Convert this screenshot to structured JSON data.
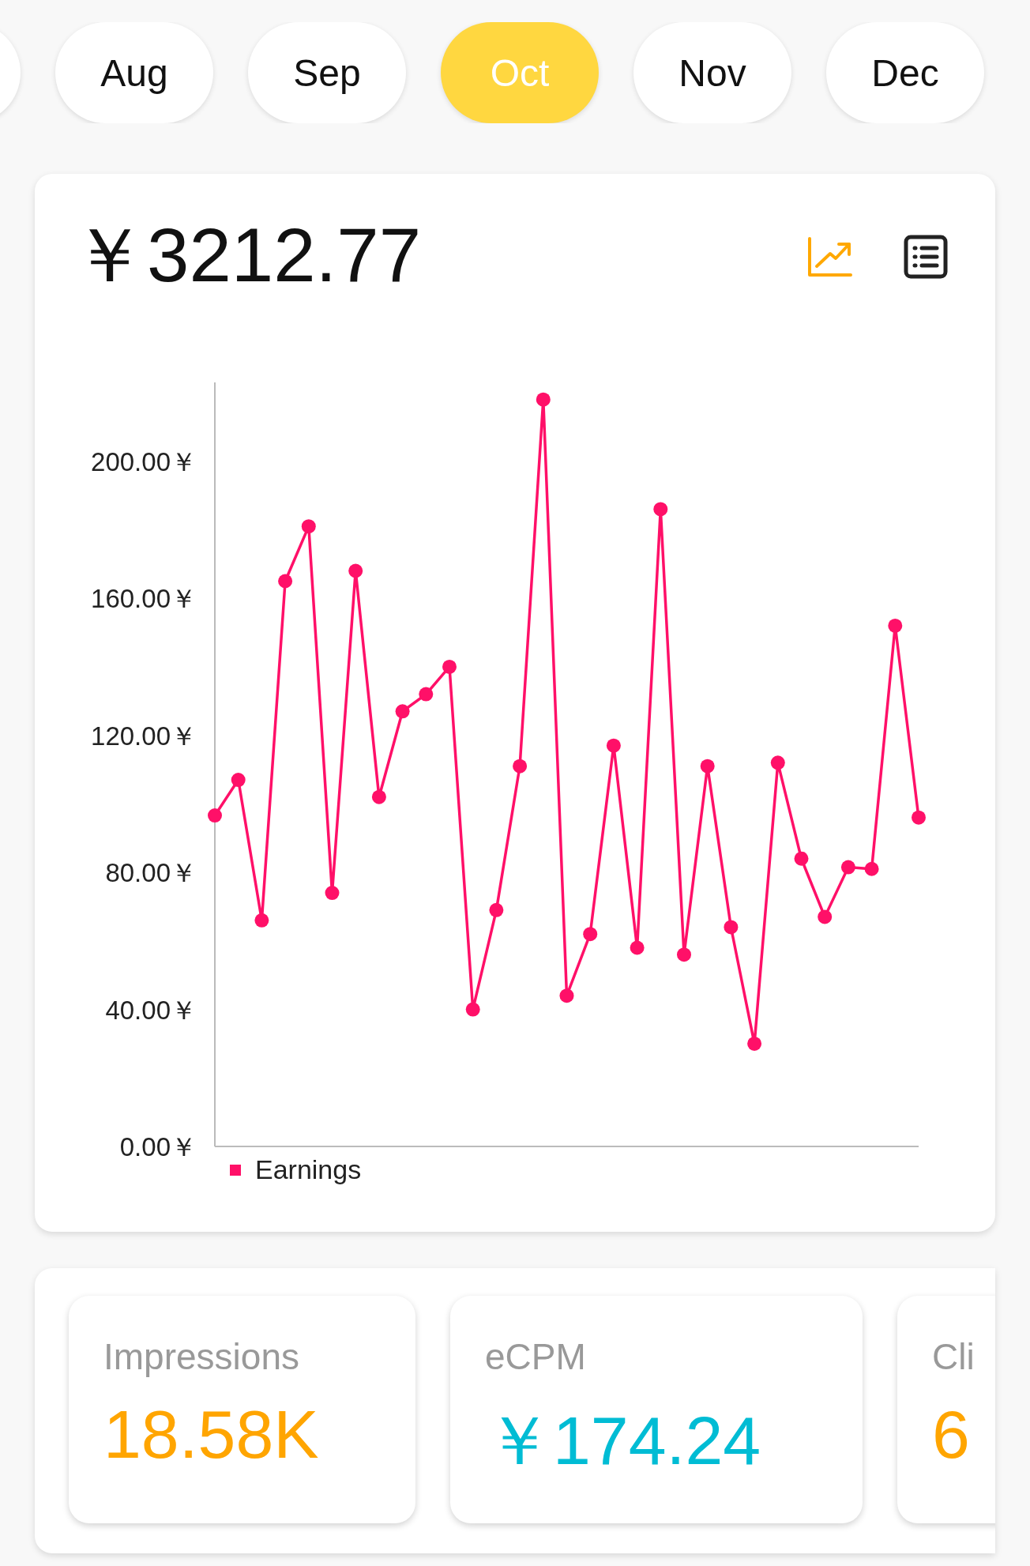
{
  "month_tabs": [
    {
      "kind": "clipped",
      "selected": false
    },
    {
      "kind": "month",
      "label": "Aug",
      "selected": false
    },
    {
      "kind": "month",
      "label": "Sep",
      "selected": false
    },
    {
      "kind": "month",
      "label": "Oct",
      "selected": true
    },
    {
      "kind": "month",
      "label": "Nov",
      "selected": false
    },
    {
      "kind": "month",
      "label": "Dec",
      "selected": false
    }
  ],
  "earnings_card": {
    "total": "￥3212.77",
    "view_toggles": [
      {
        "kind": "chart",
        "selected": true
      },
      {
        "kind": "list",
        "selected": false
      }
    ],
    "chart_data": {
      "type": "line",
      "ylim": [
        0,
        223
      ],
      "yticks": [
        {
          "value": 0,
          "label": "0.00￥"
        },
        {
          "value": 40,
          "label": "40.00￥"
        },
        {
          "value": 80,
          "label": "80.00￥"
        },
        {
          "value": 120,
          "label": "120.00￥"
        },
        {
          "value": 160,
          "label": "160.00￥"
        },
        {
          "value": 200,
          "label": "200.00￥"
        }
      ],
      "series": [
        {
          "name": "Earnings",
          "color": "#ff1068",
          "marker": "circle",
          "values": [
            96.6,
            107,
            66,
            165,
            181,
            74,
            168,
            102,
            127,
            132,
            140,
            40,
            69,
            111,
            218,
            44,
            62,
            117,
            58,
            186,
            56,
            111,
            64,
            30,
            112,
            84,
            67,
            81.5,
            81,
            152,
            96
          ]
        }
      ]
    }
  },
  "stats": [
    {
      "label": "Impressions",
      "value": "18.58K",
      "color": "#ffa500"
    },
    {
      "label": "eCPM",
      "value": "￥174.24",
      "color": "#00bcd4"
    },
    {
      "label": "Cli",
      "value": "6",
      "color": "#ffa500"
    }
  ]
}
